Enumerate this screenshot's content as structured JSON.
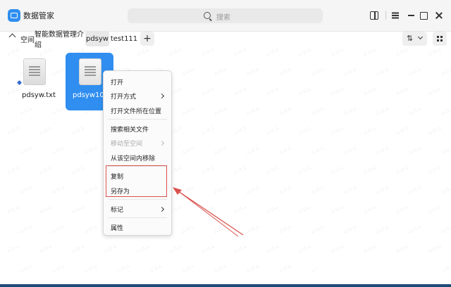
{
  "app": {
    "title": "数据管家"
  },
  "search": {
    "placeholder": "搜索"
  },
  "breadcrumb": {
    "space_label": "空间"
  },
  "tabs": [
    {
      "label": "智能数据管理介绍",
      "active": false
    },
    {
      "label": "pdsyw",
      "active": true
    },
    {
      "label": "test111",
      "active": false
    }
  ],
  "toolbar": {
    "add_label": "+",
    "sort_icon": "sort-icon",
    "view_icon": "grid-icon"
  },
  "files": [
    {
      "name": "pdsyw.txt",
      "selected": false
    },
    {
      "name": "pdsyw1024.t",
      "selected": true
    }
  ],
  "context_menu": {
    "items": [
      {
        "label": "打开",
        "submenu": false,
        "disabled": false
      },
      {
        "label": "打开方式",
        "submenu": true,
        "disabled": false
      },
      {
        "label": "打开文件所在位置",
        "submenu": false,
        "disabled": false
      },
      {
        "label": "搜索相关文件",
        "submenu": false,
        "disabled": false
      },
      {
        "label": "移动至空间",
        "submenu": true,
        "disabled": true
      },
      {
        "label": "从该空间内移除",
        "submenu": false,
        "disabled": false
      },
      {
        "label": "复制",
        "submenu": false,
        "disabled": false
      },
      {
        "label": "另存为",
        "submenu": false,
        "disabled": false
      },
      {
        "label": "标记",
        "submenu": true,
        "disabled": false
      },
      {
        "label": "属性",
        "submenu": false,
        "disabled": false
      }
    ]
  },
  "colors": {
    "accent": "#2f8ef0",
    "annotation": "#d9534f"
  }
}
